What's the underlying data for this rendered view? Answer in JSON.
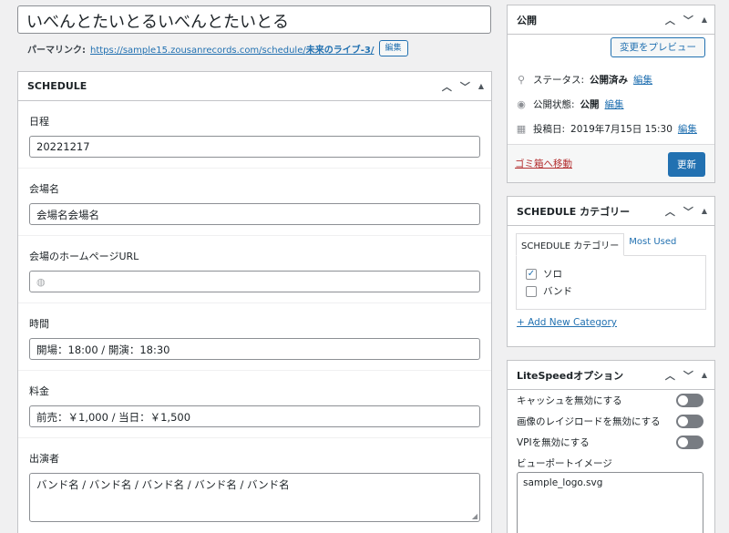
{
  "post": {
    "title": "いべんとたいとるいべんとたいとる",
    "permalink_label": "パーマリンク:",
    "permalink_base": "https://sample15.zousanrecords.com/schedule/",
    "permalink_slug": "未来のライブ-3/",
    "permalink_edit": "編集"
  },
  "schedule": {
    "title": "SCHEDULE",
    "fields": [
      {
        "label": "日程",
        "value": "20221217"
      },
      {
        "label": "会場名",
        "value": "会場名会場名"
      },
      {
        "label": "会場のホームページURL",
        "value": ""
      },
      {
        "label": "時間",
        "value": "開場：18:00 / 開演：18:30"
      },
      {
        "label": "料金",
        "value": "前売：￥1,000 / 当日：￥1,500"
      },
      {
        "label": "出演者",
        "value": "バンド名 / バンド名 / バンド名 / バンド名 / バンド名"
      }
    ]
  },
  "publish": {
    "title": "公開",
    "preview_label": "変更をプレビュー",
    "status_label": "ステータス:",
    "status_value": "公開済み",
    "visibility_label": "公開状態:",
    "visibility_value": "公開",
    "date_label": "投稿日:",
    "date_value": "2019年7月15日 15:30",
    "edit_label": "編集",
    "trash_label": "ゴミ箱へ移動",
    "update_label": "更新"
  },
  "category": {
    "title": "SCHEDULE カテゴリー",
    "tab_all": "SCHEDULE カテゴリー",
    "tab_used": "Most Used",
    "items": [
      {
        "label": "ソロ",
        "checked": true
      },
      {
        "label": "バンド",
        "checked": false
      }
    ],
    "add_label": "+ Add New Category"
  },
  "litespeed": {
    "title": "LiteSpeedオプション",
    "toggles": [
      {
        "label": "キャッシュを無効にする"
      },
      {
        "label": "画像のレイジロードを無効にする"
      },
      {
        "label": "VPIを無効にする"
      }
    ],
    "viewport_label": "ビューポートイメージ",
    "viewport_value": "sample_logo.svg"
  },
  "icons": {
    "up": "chevron-up-icon",
    "down": "chevron-down-icon",
    "toggle": "triangle-up-icon",
    "pin": "pin-icon",
    "eye": "eye-icon",
    "calendar": "calendar-icon",
    "globe": "globe-icon"
  }
}
